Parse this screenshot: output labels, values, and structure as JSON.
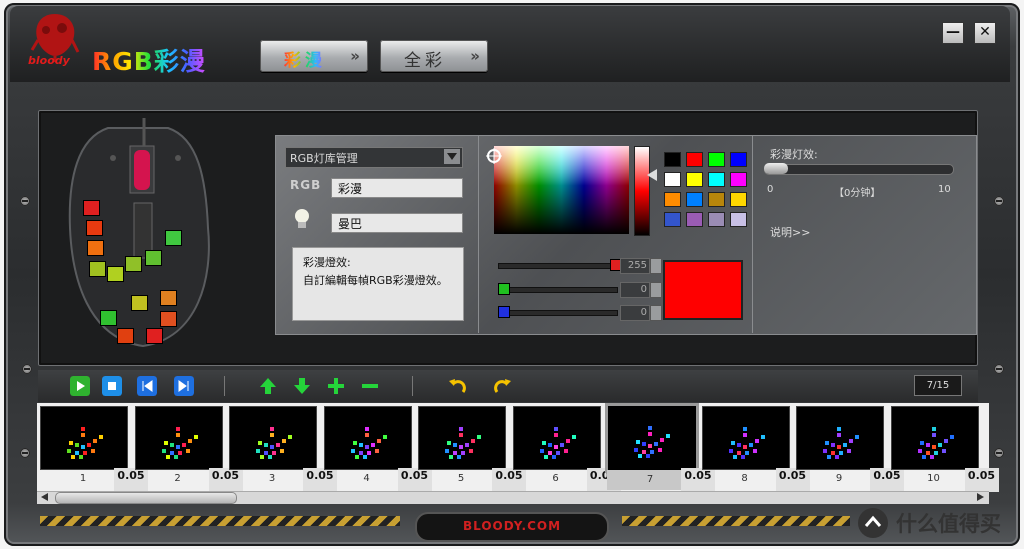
{
  "header": {
    "brand": "bloody",
    "title": "RGB彩漫",
    "tabs": [
      {
        "label": "彩漫",
        "chevron": "»",
        "active": true
      },
      {
        "label": "全彩",
        "chevron": "»",
        "active": false
      }
    ],
    "minimize": "—",
    "close": "✕"
  },
  "editor": {
    "library_select": "RGB灯库管理",
    "rgb_label": "RGB",
    "rgb_name": "彩漫",
    "light_name": "曼巴",
    "description_title": "彩漫燈效:",
    "description_body": "自訂編輯每幀RGB彩漫燈效。"
  },
  "color": {
    "swatches": [
      "#000000",
      "#ff0000",
      "#00ff00",
      "#0000ff",
      "#ffffff",
      "#ffff00",
      "#00ffff",
      "#ff00ff",
      "#ff8c00",
      "#0080ff",
      "#b8860b",
      "#ffd700",
      "#3355cc",
      "#9a5cb4",
      "#9a8cb4",
      "#c8c0e6"
    ],
    "red_value": "255",
    "green_value": "0",
    "blue_value": "0",
    "preview": "#ff0000"
  },
  "effect": {
    "label": "彩漫灯效:",
    "min": "0",
    "max": "10",
    "current": "【0分钟】",
    "help": "说明>>"
  },
  "toolbar": {
    "page": "7/15"
  },
  "frames": {
    "items": [
      {
        "label": "1",
        "dur": "0.05"
      },
      {
        "label": "2",
        "dur": "0.05"
      },
      {
        "label": "3",
        "dur": "0.05"
      },
      {
        "label": "4",
        "dur": "0.05"
      },
      {
        "label": "5",
        "dur": "0.05"
      },
      {
        "label": "6",
        "dur": "0.05"
      },
      {
        "label": "7",
        "dur": "0.05",
        "selected": true
      },
      {
        "label": "8",
        "dur": "0.05"
      },
      {
        "label": "9",
        "dur": "0.05"
      },
      {
        "label": "10",
        "dur": "0.05"
      }
    ]
  },
  "footer": {
    "site": "BLOODY.COM",
    "watermark": "什么值得买"
  }
}
